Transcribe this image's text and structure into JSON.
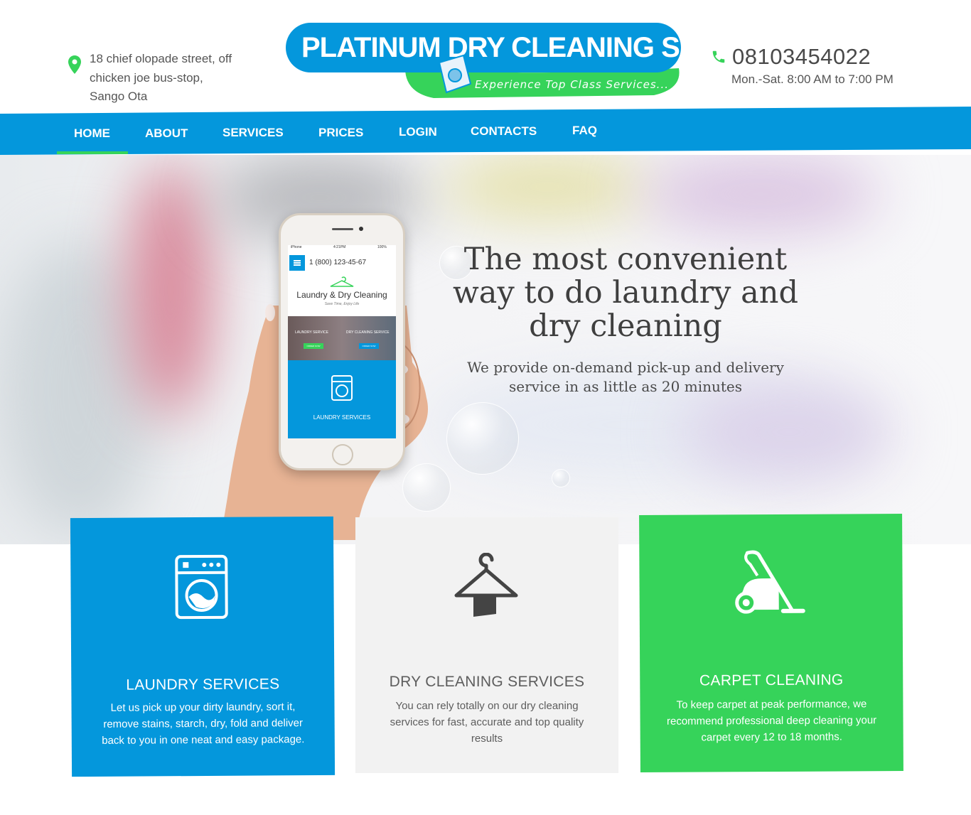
{
  "header": {
    "address": "18 chief olopade street, off chicken joe bus-stop, Sango Ota",
    "logo_title": "PLATINUM DRY CLEANING SERVICES",
    "logo_tagline": "Experience Top Class Services...",
    "phone": "08103454022",
    "hours": "Mon.-Sat. 8:00 AM to 7:00 PM",
    "colors": {
      "brand_blue": "#0497dc",
      "brand_green": "#36d35a"
    }
  },
  "nav": {
    "items": [
      {
        "label": "HOME",
        "active": true
      },
      {
        "label": "ABOUT"
      },
      {
        "label": "SERVICES"
      },
      {
        "label": "PRICES"
      },
      {
        "label": "LOGIN"
      },
      {
        "label": "CONTACTS"
      },
      {
        "label": "FAQ"
      }
    ]
  },
  "hero": {
    "headline": "The most convenient way to do laundry and dry cleaning",
    "subheadline": "We provide on-demand pick-up and delivery service in as little as 20 minutes",
    "phone_mock": {
      "status_carrier": "iPhone",
      "status_time": "4:21PM",
      "status_battery": "100%",
      "phone": "1 (800) 123-45-67",
      "title": "Laundry & Dry Cleaning",
      "tagline": "Save Time, Enjoy Life",
      "banner_left": "LAUNDRY SERVICE",
      "banner_right": "DRY CLEANING SERVICE",
      "banner_button": "ORDER NOW",
      "section_title": "LAUNDRY SERVICES"
    }
  },
  "services": [
    {
      "title": "LAUNDRY SERVICES",
      "text": "Let us pick up your dirty laundry, sort it, remove stains, starch, dry, fold and deliver back to you in one neat and easy package.",
      "icon": "washing-machine-icon"
    },
    {
      "title": "DRY CLEANING SERVICES",
      "text": "You can rely totally on our dry cleaning services for fast, accurate and top quality results",
      "icon": "hanger-icon"
    },
    {
      "title": "CARPET CLEANING",
      "text": "To keep carpet at peak performance, we recommend professional deep cleaning your carpet every 12 to 18 months.",
      "icon": "vacuum-cleaner-icon"
    }
  ]
}
